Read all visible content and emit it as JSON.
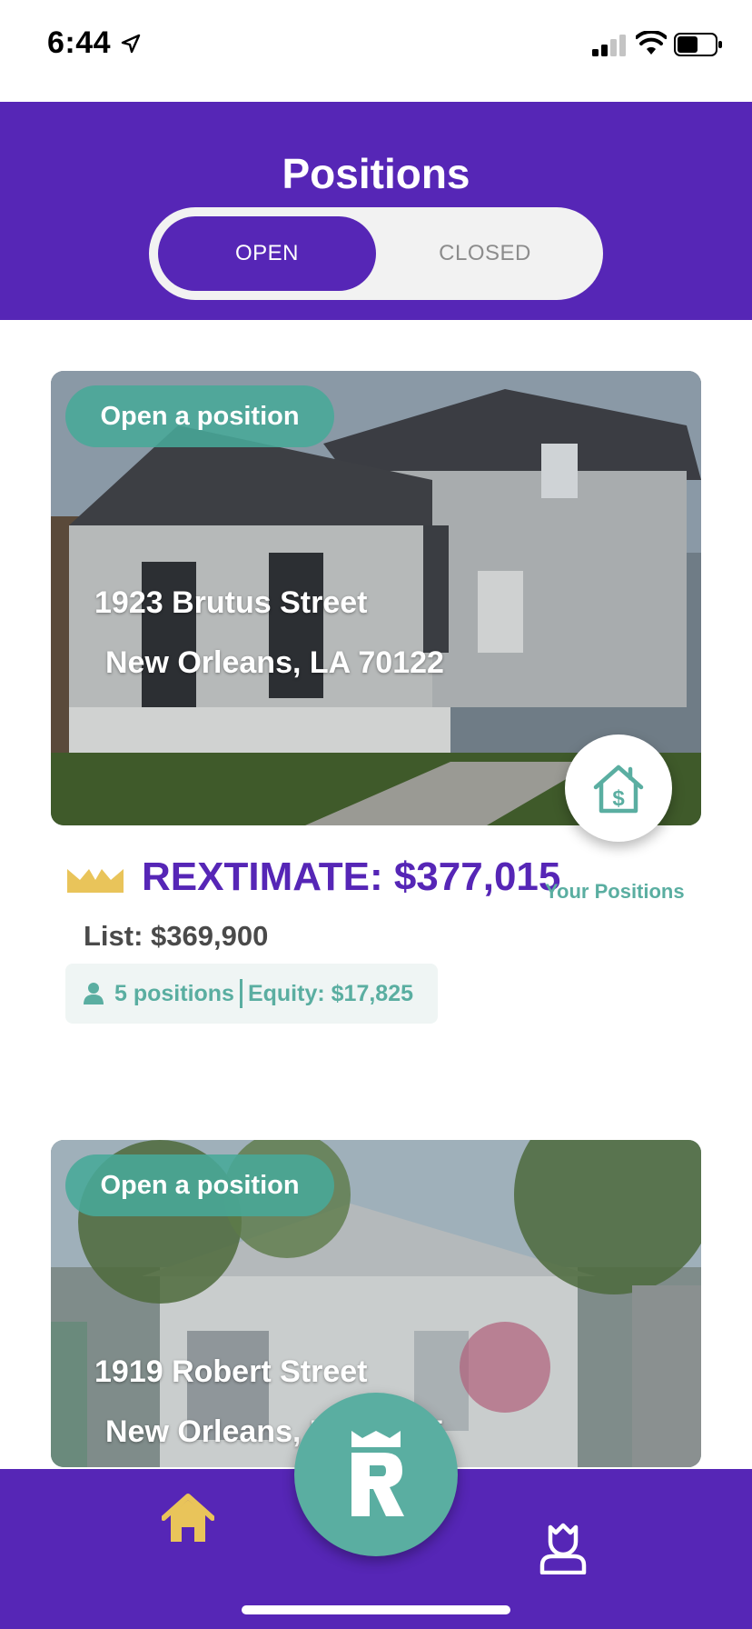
{
  "status_bar": {
    "time": "6:44"
  },
  "header": {
    "title": "Positions",
    "tabs": [
      {
        "label": "OPEN",
        "active": true
      },
      {
        "label": "CLOSED",
        "active": false
      }
    ]
  },
  "listings": [
    {
      "action_label": "Open a position",
      "street": "1923 Brutus Street",
      "city": "New Orleans, LA 70122",
      "rextimate": "REXTIMATE: $377,015",
      "your_positions_label": "Your Positions",
      "list_price": "List: $369,900",
      "positions_count": "5 positions",
      "equity": "Equity: $17,825"
    },
    {
      "action_label": "Open a position",
      "street": "1919 Robert Street",
      "city": "New Orleans, LA 70125"
    }
  ],
  "colors": {
    "brand_purple": "#5626b6",
    "teal": "#5aaea1",
    "gold": "#e9c45a"
  },
  "icons": {
    "house_dollar": "house-dollar-icon",
    "crown": "crown-icon",
    "person": "person-icon",
    "home": "home-icon",
    "profile": "profile-icon",
    "logo": "rex-logo-icon"
  }
}
